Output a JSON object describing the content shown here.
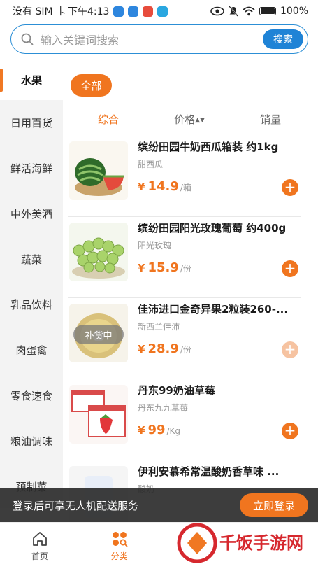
{
  "status_bar": {
    "carrier": "没有 SIM 卡",
    "time": "下午4:13",
    "battery": "100%"
  },
  "search": {
    "placeholder": "输入关键词搜索",
    "button": "搜索"
  },
  "sidebar": {
    "items": [
      {
        "label": "水果"
      },
      {
        "label": "日用百货"
      },
      {
        "label": "鲜活海鲜"
      },
      {
        "label": "中外美酒"
      },
      {
        "label": "蔬菜"
      },
      {
        "label": "乳品饮料"
      },
      {
        "label": "肉蛋禽"
      },
      {
        "label": "零食速食"
      },
      {
        "label": "粮油调味"
      },
      {
        "label": "预制菜"
      }
    ]
  },
  "filter": {
    "all": "全部"
  },
  "sort": {
    "comprehensive": "综合",
    "price": "价格",
    "sales": "销量"
  },
  "products": [
    {
      "title": "缤纷田园牛奶西瓜箱装 约1kg",
      "subtitle": "甜西瓜",
      "currency": "¥",
      "price": "14.9",
      "unit": "/箱"
    },
    {
      "title": "缤纷田园阳光玫瑰葡萄 约400g",
      "subtitle": "阳光玫瑰",
      "currency": "¥",
      "price": "15.9",
      "unit": "/份"
    },
    {
      "title": "佳沛进口金奇异果2粒装260-...",
      "subtitle": "新西兰佳沛",
      "currency": "¥",
      "price": "28.9",
      "unit": "/份",
      "badge": "补货中"
    },
    {
      "title": "丹东99奶油草莓",
      "subtitle": "丹东九九草莓",
      "currency": "¥",
      "price": "99",
      "unit": "/Kg"
    },
    {
      "title": "伊利安慕希常温酸奶香草味 ...",
      "subtitle": "酸奶"
    }
  ],
  "login_banner": {
    "text": "登录后可享无人机配送服务",
    "button": "立即登录"
  },
  "bottom_nav": {
    "home": "首页",
    "category": "分类"
  },
  "watermark": {
    "text": "千饭手游网"
  },
  "colors": {
    "accent": "#f0751f",
    "search_blue": "#1f83d6"
  }
}
